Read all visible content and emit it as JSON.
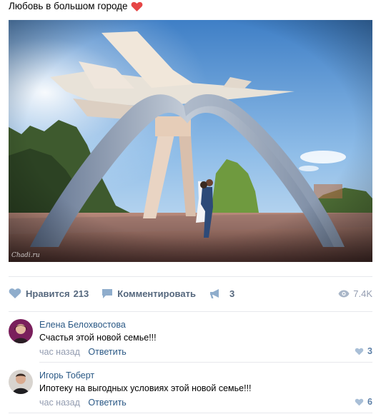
{
  "post": {
    "title": "Любовь в большом городе",
    "title_emoji": "heart-icon",
    "photo_watermark": "Chadi.ru"
  },
  "actions": {
    "like_label": "Нравится",
    "like_count": "213",
    "comment_label": "Комментировать",
    "share_count": "3",
    "views_count": "7.4K"
  },
  "comments": [
    {
      "author": "Елена Белохвостова",
      "text": "Счастья этой новой семье!!!",
      "time": "час назад",
      "reply_label": "Ответить",
      "likes": "3"
    },
    {
      "author": "Игорь Тоберт",
      "text": "Ипотеку на выгодных условиях этой новой семье!!!",
      "time": "час назад",
      "reply_label": "Ответить",
      "likes": "6"
    }
  ],
  "colors": {
    "link": "#2a5885",
    "action_text": "#55677d",
    "muted": "#939cb0",
    "heart": "#e64646"
  }
}
